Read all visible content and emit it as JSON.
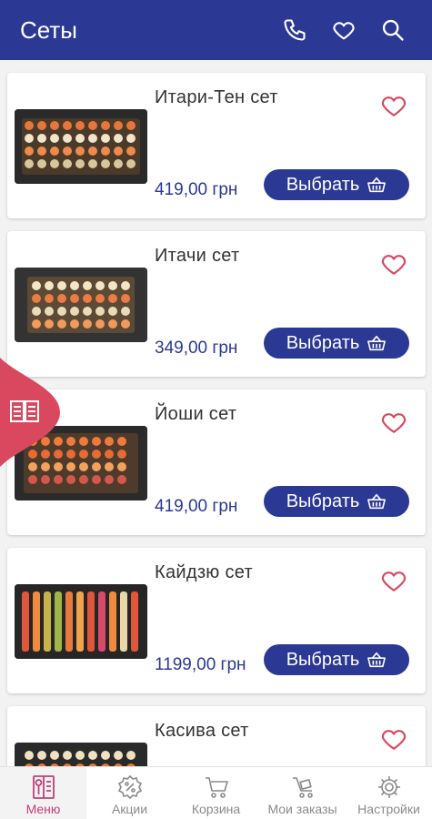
{
  "app_bar": {
    "title": "Сеты",
    "actions": [
      "phone-icon",
      "heart-icon",
      "search-icon"
    ]
  },
  "products": [
    {
      "name": "Итари-Тен сет",
      "price": "419,00 грн",
      "button": "Выбрать"
    },
    {
      "name": "Итачи сет",
      "price": "349,00 грн",
      "button": "Выбрать"
    },
    {
      "name": "Йоши сет",
      "price": "419,00 грн",
      "button": "Выбрать"
    },
    {
      "name": "Кайдзю сет",
      "price": "1199,00 грн",
      "button": "Выбрать"
    },
    {
      "name": "Касива сет",
      "price": "",
      "button": ""
    }
  ],
  "side_tab": {
    "icon": "menu-book-icon"
  },
  "bottom_nav": {
    "items": [
      {
        "label": "Меню",
        "icon": "menu-icon",
        "active": true
      },
      {
        "label": "Акции",
        "icon": "discount-icon",
        "active": false
      },
      {
        "label": "Корзина",
        "icon": "cart-icon",
        "active": false
      },
      {
        "label": "Мои заказы",
        "icon": "orders-icon",
        "active": false
      },
      {
        "label": "Настройки",
        "icon": "gear-icon",
        "active": false
      }
    ]
  },
  "colors": {
    "primary": "#2b3894",
    "accent": "#d9485f",
    "active_tab": "#c0407a"
  }
}
